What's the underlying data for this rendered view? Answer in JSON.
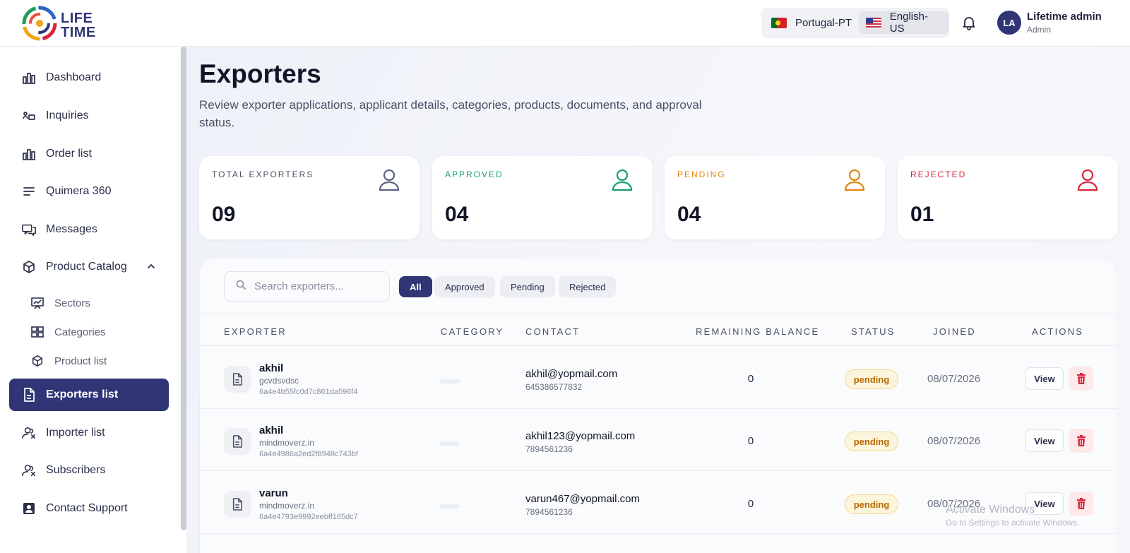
{
  "brand": {
    "logo_line1": "LIFE",
    "logo_line2": "TIME"
  },
  "header": {
    "languages": [
      {
        "label": "Portugal-PT",
        "flag": "portugal-flag"
      },
      {
        "label": "English-US",
        "flag": "us-flag",
        "selected": true
      }
    ],
    "user": {
      "initials": "LA",
      "name": "Lifetime admin",
      "role": "Admin"
    }
  },
  "sidebar": {
    "items": [
      {
        "label": "Dashboard",
        "icon": "bar-chart-icon"
      },
      {
        "label": "Inquiries",
        "icon": "inquiries-icon"
      },
      {
        "label": "Order list",
        "icon": "bar-chart-icon"
      },
      {
        "label": "Quimera 360",
        "icon": "lines-icon"
      },
      {
        "label": "Messages",
        "icon": "messages-icon"
      },
      {
        "label": "Product Catalog",
        "icon": "cube-icon",
        "expanded": true
      },
      {
        "label": "Sectors",
        "icon": "presentation-icon",
        "sub": true
      },
      {
        "label": "Categories",
        "icon": "grid-icon",
        "sub": true
      },
      {
        "label": "Product list",
        "icon": "cube-icon",
        "sub": true
      },
      {
        "label": "Exporters list",
        "icon": "document-icon",
        "active": true
      },
      {
        "label": "Importer list",
        "icon": "users-icon"
      },
      {
        "label": "Subscribers",
        "icon": "users-icon"
      },
      {
        "label": "Contact Support",
        "icon": "contact-card-icon"
      }
    ]
  },
  "page": {
    "title": "Exporters",
    "description": "Review exporter applications, applicant details, categories, products, documents, and approval status."
  },
  "stats": [
    {
      "label": "TOTAL EXPORTERS",
      "value": "09",
      "color": "#4b5066"
    },
    {
      "label": "APPROVED",
      "value": "04",
      "color": "#16a06a"
    },
    {
      "label": "PENDING",
      "value": "04",
      "color": "#e0860f"
    },
    {
      "label": "REJECTED",
      "value": "01",
      "color": "#d7263d"
    }
  ],
  "search": {
    "placeholder": "Search exporters..."
  },
  "filters": [
    "All",
    "Approved",
    "Pending",
    "Rejected"
  ],
  "table": {
    "columns": [
      "EXPORTER",
      "CATEGORY",
      "CONTACT",
      "REMAINING BALANCE",
      "STATUS",
      "JOINED",
      "ACTIONS"
    ],
    "rows": [
      {
        "name": "akhil",
        "domain": "gcvdsvdsc",
        "id": "6a4e4b55fc0d7c861da596f4",
        "email": "akhil@yopmail.com",
        "phone": "645386577832",
        "balance": "0",
        "status": "pending",
        "joined": "08/07/2026",
        "view": "View"
      },
      {
        "name": "akhil",
        "domain": "mindmoverz.in",
        "id": "6a4e4986a2ed2f8948c743bf",
        "email": "akhil123@yopmail.com",
        "phone": "7894561236",
        "balance": "0",
        "status": "pending",
        "joined": "08/07/2026",
        "view": "View"
      },
      {
        "name": "varun",
        "domain": "mindmoverz.in",
        "id": "6a4e4793e9992eebff165dc7",
        "email": "varun467@yopmail.com",
        "phone": "7894561236",
        "balance": "0",
        "status": "pending",
        "joined": "08/07/2026",
        "view": "View"
      }
    ]
  },
  "watermark": {
    "line1": "Activate Windows",
    "line2": "Go to Settings to activate Windows."
  }
}
